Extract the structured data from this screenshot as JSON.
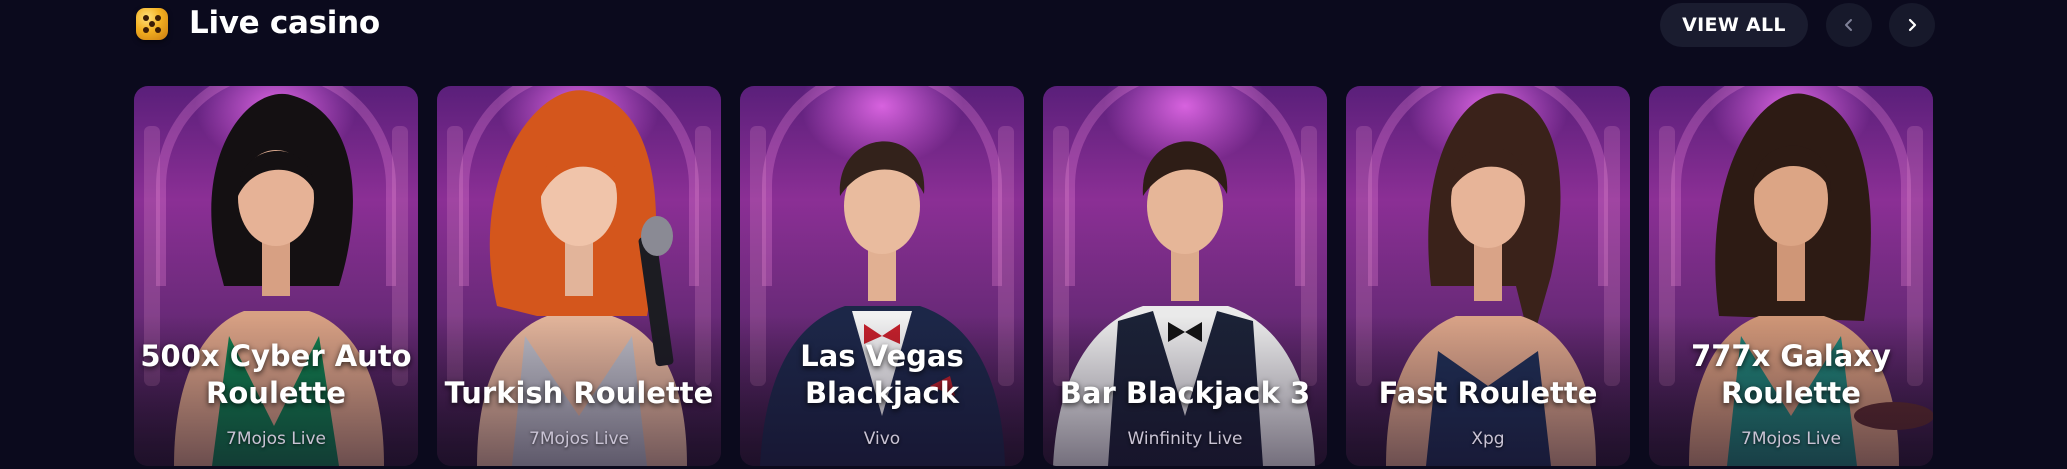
{
  "section": {
    "title": "Live casino",
    "icon": "dice-icon",
    "view_all_label": "VIEW ALL",
    "prev_icon": "chevron-left-icon",
    "next_icon": "chevron-right-icon"
  },
  "colors": {
    "background": "#0b0a1d",
    "button": "#1a1c2f",
    "card_purple": "#8b2f95",
    "provider_text": "#c9c3d4"
  },
  "games": [
    {
      "title": "500x Cyber Auto Roulette",
      "provider": "7Mojos Live",
      "image": "woman-green-dress-portrait"
    },
    {
      "title": "Turkish Roulette",
      "provider": "7Mojos Live",
      "image": "redhead-woman-microphone-portrait"
    },
    {
      "title": "Las Vegas Blackjack",
      "provider": "Vivo",
      "image": "man-navy-suit-red-bowtie-portrait"
    },
    {
      "title": "Bar Blackjack 3",
      "provider": "Winfinity Live",
      "image": "man-vest-black-bowtie-portrait"
    },
    {
      "title": "Fast Roulette",
      "provider": "Xpg",
      "image": "woman-navy-dress-portrait"
    },
    {
      "title": "777x Galaxy Roulette",
      "provider": "7Mojos Live",
      "image": "woman-teal-dress-portrait"
    }
  ]
}
